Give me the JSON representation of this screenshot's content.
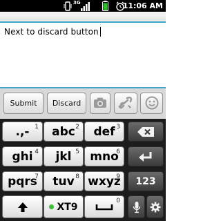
{
  "status_bar": {
    "time": "11:06 AM",
    "network_label": "3G",
    "icons": [
      "vibrate-icon",
      "signal-icon",
      "battery-icon",
      "alarm-icon"
    ]
  },
  "compose": {
    "text": "Next to discard button"
  },
  "actions": {
    "submit_label": "Submit",
    "discard_label": "Discard",
    "icons": [
      "camera-icon",
      "link-icon",
      "smiley-icon"
    ]
  },
  "keyboard": {
    "row1": [
      {
        "main": ".,-",
        "num": "1"
      },
      {
        "main": "abc",
        "num": "2"
      },
      {
        "main": "def",
        "num": "3"
      }
    ],
    "row2": [
      {
        "main": "ghi",
        "num": "4"
      },
      {
        "main": "jkl",
        "num": "5"
      },
      {
        "main": "mno",
        "num": "6"
      }
    ],
    "row3": [
      {
        "main": "pqrs",
        "num": "7"
      },
      {
        "main": "tuv",
        "num": "8"
      },
      {
        "main": "wxyz",
        "num": "9"
      }
    ],
    "mode_label": "123",
    "xt9_label": "XT9",
    "space_num": "0",
    "accent_color": "#3fa6d4",
    "xt9_dot_color": "#3bbf3b"
  }
}
